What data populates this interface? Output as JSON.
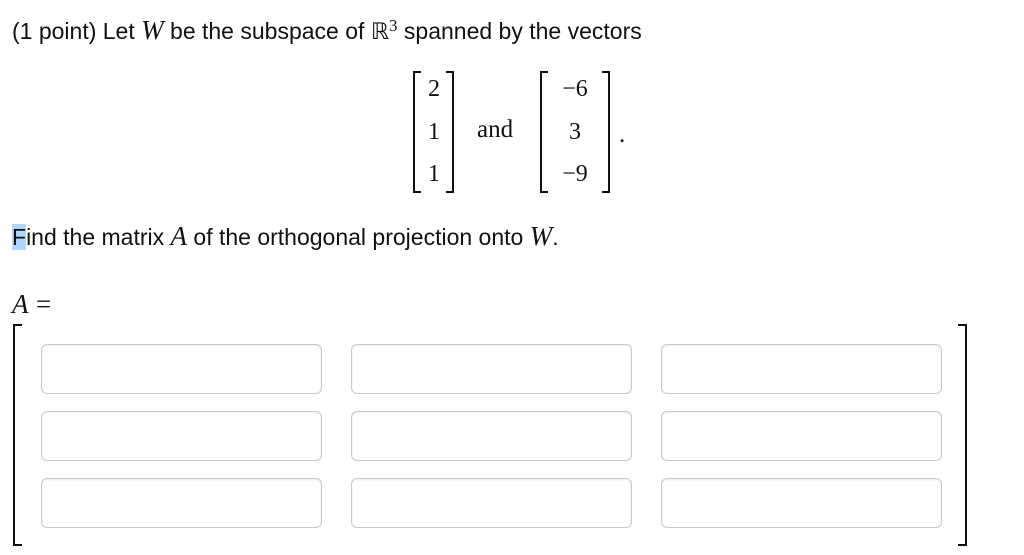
{
  "problem": {
    "points": "(1 point)",
    "text_let": "Let",
    "var_w": "W",
    "text_be": "be the subspace of",
    "reals_symbol": "ℝ",
    "reals_exponent": "3",
    "text_spanned": "spanned by the vectors"
  },
  "vectors": {
    "v1": [
      "2",
      "1",
      "1"
    ],
    "v2": [
      "−6",
      "3",
      "−9"
    ],
    "conjunction": "and",
    "period": "."
  },
  "question": {
    "first_letter": "F",
    "text_part1": "ind the matrix",
    "var_a": "A",
    "text_part2": "of the orthogonal projection onto",
    "var_w": "W",
    "end": "."
  },
  "answer": {
    "var_a": "A",
    "equals": "=",
    "cells": [
      [
        "",
        "",
        ""
      ],
      [
        "",
        "",
        ""
      ],
      [
        "",
        "",
        ""
      ]
    ]
  }
}
